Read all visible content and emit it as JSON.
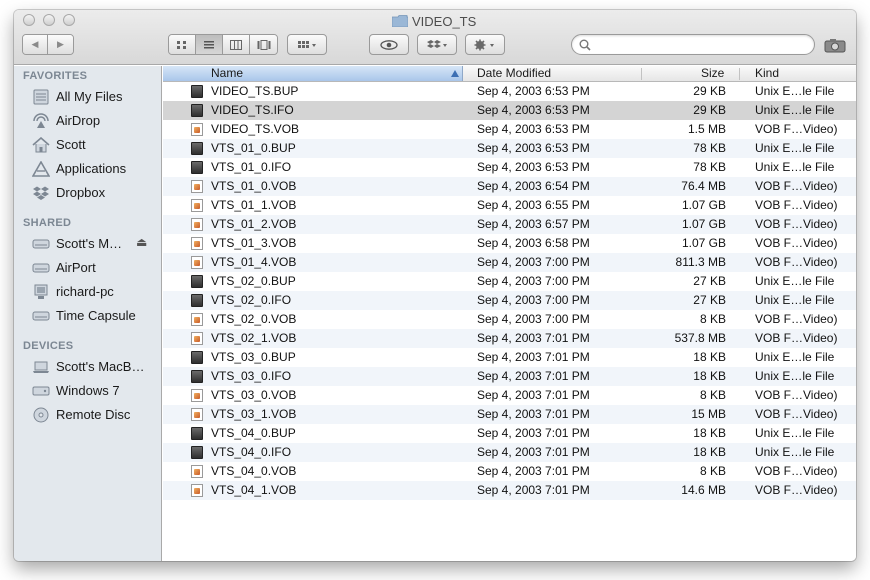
{
  "window": {
    "title": "VIDEO_TS"
  },
  "toolbar": {
    "nav_back": "◀",
    "nav_forward": "▶",
    "search": {
      "placeholder": "",
      "value": ""
    }
  },
  "sidebar": {
    "sections": [
      {
        "heading": "FAVORITES",
        "items": [
          {
            "label": "All My Files",
            "icon": "all-files-icon"
          },
          {
            "label": "AirDrop",
            "icon": "airdrop-icon"
          },
          {
            "label": "Scott",
            "icon": "home-icon"
          },
          {
            "label": "Applications",
            "icon": "applications-icon"
          },
          {
            "label": "Dropbox",
            "icon": "dropbox-icon"
          }
        ]
      },
      {
        "heading": "SHARED",
        "items": [
          {
            "label": "Scott's M…",
            "icon": "shared-disk-icon",
            "eject": "⏏"
          },
          {
            "label": "AirPort",
            "icon": "shared-disk-icon"
          },
          {
            "label": "richard-pc",
            "icon": "pc-icon"
          },
          {
            "label": "Time Capsule",
            "icon": "shared-disk-icon"
          }
        ]
      },
      {
        "heading": "DEVICES",
        "items": [
          {
            "label": "Scott's MacB…",
            "icon": "laptop-icon"
          },
          {
            "label": "Windows 7",
            "icon": "hard-disk-icon"
          },
          {
            "label": "Remote Disc",
            "icon": "disc-icon"
          }
        ]
      }
    ]
  },
  "columns": {
    "name": "Name",
    "date": "Date Modified",
    "size": "Size",
    "kind": "Kind"
  },
  "files": [
    {
      "name": "VIDEO_TS.BUP",
      "date": "Sep 4, 2003 6:53 PM",
      "size": "29 KB",
      "kind": "Unix E…le File",
      "type": "bin"
    },
    {
      "name": "VIDEO_TS.IFO",
      "date": "Sep 4, 2003 6:53 PM",
      "size": "29 KB",
      "kind": "Unix E…le File",
      "type": "bin",
      "selected": true
    },
    {
      "name": "VIDEO_TS.VOB",
      "date": "Sep 4, 2003 6:53 PM",
      "size": "1.5 MB",
      "kind": "VOB F…Video)",
      "type": "vob"
    },
    {
      "name": "VTS_01_0.BUP",
      "date": "Sep 4, 2003 6:53 PM",
      "size": "78 KB",
      "kind": "Unix E…le File",
      "type": "bin"
    },
    {
      "name": "VTS_01_0.IFO",
      "date": "Sep 4, 2003 6:53 PM",
      "size": "78 KB",
      "kind": "Unix E…le File",
      "type": "bin"
    },
    {
      "name": "VTS_01_0.VOB",
      "date": "Sep 4, 2003 6:54 PM",
      "size": "76.4 MB",
      "kind": "VOB F…Video)",
      "type": "vob"
    },
    {
      "name": "VTS_01_1.VOB",
      "date": "Sep 4, 2003 6:55 PM",
      "size": "1.07 GB",
      "kind": "VOB F…Video)",
      "type": "vob"
    },
    {
      "name": "VTS_01_2.VOB",
      "date": "Sep 4, 2003 6:57 PM",
      "size": "1.07 GB",
      "kind": "VOB F…Video)",
      "type": "vob"
    },
    {
      "name": "VTS_01_3.VOB",
      "date": "Sep 4, 2003 6:58 PM",
      "size": "1.07 GB",
      "kind": "VOB F…Video)",
      "type": "vob"
    },
    {
      "name": "VTS_01_4.VOB",
      "date": "Sep 4, 2003 7:00 PM",
      "size": "811.3 MB",
      "kind": "VOB F…Video)",
      "type": "vob"
    },
    {
      "name": "VTS_02_0.BUP",
      "date": "Sep 4, 2003 7:00 PM",
      "size": "27 KB",
      "kind": "Unix E…le File",
      "type": "bin"
    },
    {
      "name": "VTS_02_0.IFO",
      "date": "Sep 4, 2003 7:00 PM",
      "size": "27 KB",
      "kind": "Unix E…le File",
      "type": "bin"
    },
    {
      "name": "VTS_02_0.VOB",
      "date": "Sep 4, 2003 7:00 PM",
      "size": "8 KB",
      "kind": "VOB F…Video)",
      "type": "vob"
    },
    {
      "name": "VTS_02_1.VOB",
      "date": "Sep 4, 2003 7:01 PM",
      "size": "537.8 MB",
      "kind": "VOB F…Video)",
      "type": "vob"
    },
    {
      "name": "VTS_03_0.BUP",
      "date": "Sep 4, 2003 7:01 PM",
      "size": "18 KB",
      "kind": "Unix E…le File",
      "type": "bin"
    },
    {
      "name": "VTS_03_0.IFO",
      "date": "Sep 4, 2003 7:01 PM",
      "size": "18 KB",
      "kind": "Unix E…le File",
      "type": "bin"
    },
    {
      "name": "VTS_03_0.VOB",
      "date": "Sep 4, 2003 7:01 PM",
      "size": "8 KB",
      "kind": "VOB F…Video)",
      "type": "vob"
    },
    {
      "name": "VTS_03_1.VOB",
      "date": "Sep 4, 2003 7:01 PM",
      "size": "15 MB",
      "kind": "VOB F…Video)",
      "type": "vob"
    },
    {
      "name": "VTS_04_0.BUP",
      "date": "Sep 4, 2003 7:01 PM",
      "size": "18 KB",
      "kind": "Unix E…le File",
      "type": "bin"
    },
    {
      "name": "VTS_04_0.IFO",
      "date": "Sep 4, 2003 7:01 PM",
      "size": "18 KB",
      "kind": "Unix E…le File",
      "type": "bin"
    },
    {
      "name": "VTS_04_0.VOB",
      "date": "Sep 4, 2003 7:01 PM",
      "size": "8 KB",
      "kind": "VOB F…Video)",
      "type": "vob"
    },
    {
      "name": "VTS_04_1.VOB",
      "date": "Sep 4, 2003 7:01 PM",
      "size": "14.6 MB",
      "kind": "VOB F…Video)",
      "type": "vob"
    }
  ],
  "colors": {
    "sidebar_bg": "#e3e8ed",
    "row_alt": "#f1f5fa",
    "selected_row": "#d4d4d4",
    "sort_header": "#a9c6ea"
  }
}
